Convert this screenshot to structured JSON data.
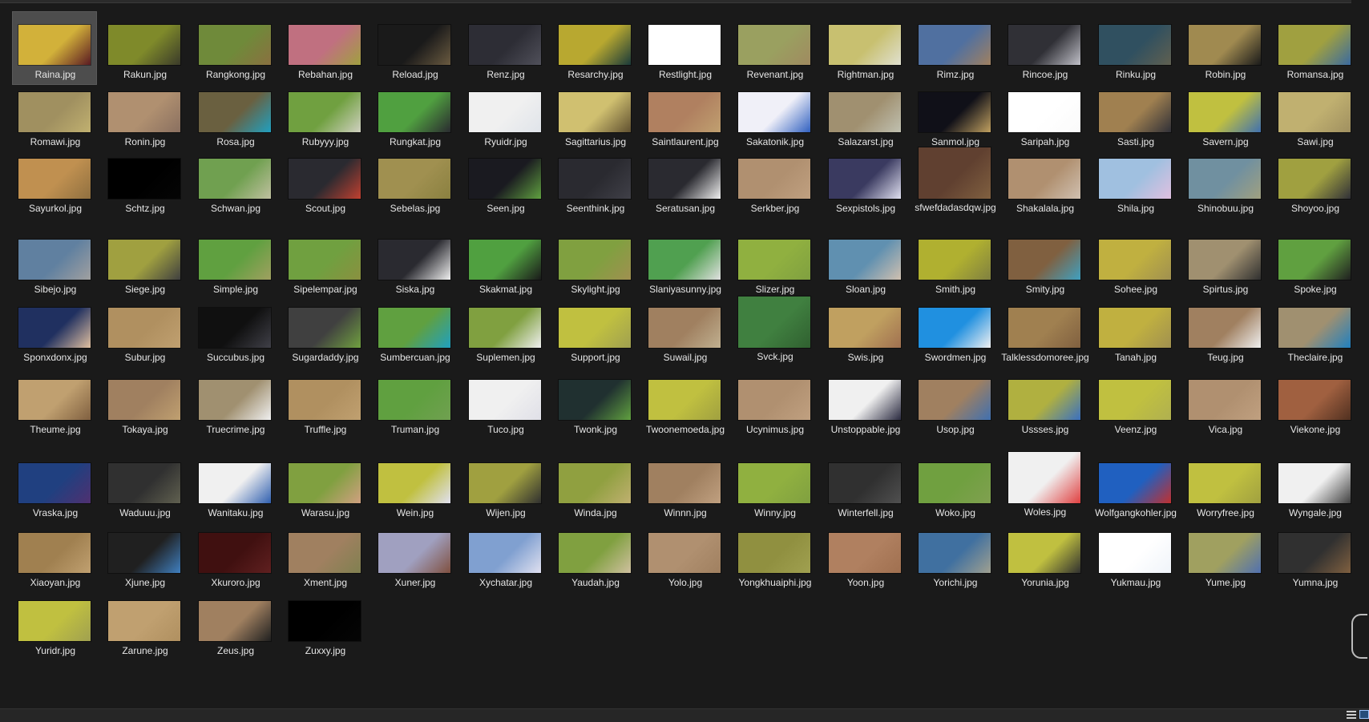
{
  "files": [
    {
      "name": "Raina.jpg",
      "thumb": [
        "#d2b13a",
        "#5a1a22"
      ],
      "selected": true
    },
    {
      "name": "Rakun.jpg",
      "thumb": [
        "#7f8a2a",
        "#3a3a2a"
      ]
    },
    {
      "name": "Rangkong.jpg",
      "thumb": [
        "#6f8a3a",
        "#8a7040"
      ]
    },
    {
      "name": "Rebahan.jpg",
      "thumb": [
        "#c07080",
        "#a0a040"
      ]
    },
    {
      "name": "Reload.jpg",
      "thumb": [
        "#1a1a1a",
        "#6a5a40"
      ]
    },
    {
      "name": "Renz.jpg",
      "thumb": [
        "#2d2d35",
        "#50505a"
      ]
    },
    {
      "name": "Resarchy.jpg",
      "thumb": [
        "#b8a830",
        "#1a3a3a"
      ]
    },
    {
      "name": "Restlight.jpg",
      "thumb": [
        "#ffffff",
        "#ffffff"
      ]
    },
    {
      "name": "Revenant.jpg",
      "thumb": [
        "#9aa060",
        "#a08a60"
      ]
    },
    {
      "name": "Rightman.jpg",
      "thumb": [
        "#c8c070",
        "#e0e0d0"
      ]
    },
    {
      "name": "Rimz.jpg",
      "thumb": [
        "#5070a0",
        "#a08060"
      ]
    },
    {
      "name": "Rincoe.jpg",
      "thumb": [
        "#303036",
        "#c0c0c8"
      ]
    },
    {
      "name": "Rinku.jpg",
      "thumb": [
        "#305060",
        "#606050"
      ]
    },
    {
      "name": "Robin.jpg",
      "thumb": [
        "#a08a50",
        "#1a1a1a"
      ]
    },
    {
      "name": "Romansa.jpg",
      "thumb": [
        "#a0a040",
        "#3a6aa0"
      ]
    },
    {
      "name": "Romawi.jpg",
      "thumb": [
        "#a09060",
        "#c0b070"
      ]
    },
    {
      "name": "Ronin.jpg",
      "thumb": [
        "#b09070",
        "#8a7060"
      ]
    },
    {
      "name": "Rosa.jpg",
      "thumb": [
        "#6a6040",
        "#20a0c0"
      ]
    },
    {
      "name": "Rubyyy.jpg",
      "thumb": [
        "#70a040",
        "#d0d0c0"
      ]
    },
    {
      "name": "Rungkat.jpg",
      "thumb": [
        "#50a040",
        "#2a2a30"
      ]
    },
    {
      "name": "Ryuidr.jpg",
      "thumb": [
        "#f0f0f0",
        "#e0e4ea"
      ]
    },
    {
      "name": "Sagittarius.jpg",
      "thumb": [
        "#d0c070",
        "#605030"
      ]
    },
    {
      "name": "Saintlaurent.jpg",
      "thumb": [
        "#b08060",
        "#c0a070"
      ]
    },
    {
      "name": "Sakatonik.jpg",
      "thumb": [
        "#f0f0f8",
        "#3060c0"
      ]
    },
    {
      "name": "Salazarst.jpg",
      "thumb": [
        "#a09070",
        "#c0c0b0"
      ]
    },
    {
      "name": "Sanmol.jpg",
      "thumb": [
        "#101018",
        "#c0a060"
      ]
    },
    {
      "name": "Saripah.jpg",
      "thumb": [
        "#ffffff",
        "#fafafa"
      ]
    },
    {
      "name": "Sasti.jpg",
      "thumb": [
        "#a08050",
        "#303038"
      ]
    },
    {
      "name": "Savern.jpg",
      "thumb": [
        "#c0c040",
        "#4070b0"
      ]
    },
    {
      "name": "Sawi.jpg",
      "thumb": [
        "#c0b070",
        "#a09060"
      ]
    },
    {
      "name": "Sayurkol.jpg",
      "thumb": [
        "#c09050",
        "#907040"
      ]
    },
    {
      "name": "Schtz.jpg",
      "thumb": [
        "#000000",
        "#050505"
      ]
    },
    {
      "name": "Schwan.jpg",
      "thumb": [
        "#70a050",
        "#c0c0a0"
      ]
    },
    {
      "name": "Scout.jpg",
      "thumb": [
        "#2a2a30",
        "#c04030"
      ]
    },
    {
      "name": "Sebelas.jpg",
      "thumb": [
        "#a09050",
        "#8a8040"
      ]
    },
    {
      "name": "Seen.jpg",
      "thumb": [
        "#1a1a20",
        "#60a040"
      ]
    },
    {
      "name": "Seenthink.jpg",
      "thumb": [
        "#2a2a30",
        "#404048"
      ]
    },
    {
      "name": "Seratusan.jpg",
      "thumb": [
        "#2a2a30",
        "#f0f0f0"
      ]
    },
    {
      "name": "Serkber.jpg",
      "thumb": [
        "#b09070",
        "#c0a080"
      ]
    },
    {
      "name": "Sexpistols.jpg",
      "thumb": [
        "#3a3a60",
        "#e0e0f0"
      ]
    },
    {
      "name": "sfwefdadasdqw.jpg",
      "thumb": [
        "#604030",
        "#806040"
      ],
      "tall": true
    },
    {
      "name": "Shakalala.jpg",
      "thumb": [
        "#b09070",
        "#d0c0b0"
      ]
    },
    {
      "name": "Shila.jpg",
      "thumb": [
        "#a0c0e0",
        "#e0c0e0"
      ]
    },
    {
      "name": "Shinobuu.jpg",
      "thumb": [
        "#7090a0",
        "#a0a080"
      ]
    },
    {
      "name": "Shoyoo.jpg",
      "thumb": [
        "#a0a040",
        "#303038"
      ]
    },
    {
      "name": "Sibejo.jpg",
      "thumb": [
        "#6080a0",
        "#a0a0a0"
      ]
    },
    {
      "name": "Siege.jpg",
      "thumb": [
        "#a0a040",
        "#404040"
      ]
    },
    {
      "name": "Simple.jpg",
      "thumb": [
        "#60a040",
        "#a0a060"
      ]
    },
    {
      "name": "Sipelempar.jpg",
      "thumb": [
        "#70a040",
        "#8a9040"
      ]
    },
    {
      "name": "Siska.jpg",
      "thumb": [
        "#2a2a30",
        "#f0f0f0"
      ]
    },
    {
      "name": "Skakmat.jpg",
      "thumb": [
        "#50a040",
        "#1a1a1a"
      ]
    },
    {
      "name": "Skylight.jpg",
      "thumb": [
        "#80a040",
        "#a09050"
      ]
    },
    {
      "name": "Slaniyasunny.jpg",
      "thumb": [
        "#50a050",
        "#e0e0e0"
      ]
    },
    {
      "name": "Slizer.jpg",
      "thumb": [
        "#90b040",
        "#80a040"
      ]
    },
    {
      "name": "Sloan.jpg",
      "thumb": [
        "#6090b0",
        "#d0c0b0"
      ]
    },
    {
      "name": "Smith.jpg",
      "thumb": [
        "#b0b030",
        "#808040"
      ]
    },
    {
      "name": "Smity.jpg",
      "thumb": [
        "#806040",
        "#40a0c0"
      ]
    },
    {
      "name": "Sohee.jpg",
      "thumb": [
        "#c0b040",
        "#a09050"
      ]
    },
    {
      "name": "Spirtus.jpg",
      "thumb": [
        "#a09070",
        "#303030"
      ]
    },
    {
      "name": "Spoke.jpg",
      "thumb": [
        "#60a040",
        "#202020"
      ]
    },
    {
      "name": "Sponxdonx.jpg",
      "thumb": [
        "#203060",
        "#e0c0a0"
      ]
    },
    {
      "name": "Subur.jpg",
      "thumb": [
        "#b09060",
        "#c0a070"
      ]
    },
    {
      "name": "Succubus.jpg",
      "thumb": [
        "#101010",
        "#404048"
      ]
    },
    {
      "name": "Sugardaddy.jpg",
      "thumb": [
        "#404040",
        "#70a040"
      ]
    },
    {
      "name": "Sumbercuan.jpg",
      "thumb": [
        "#60a040",
        "#20a0c0"
      ]
    },
    {
      "name": "Suplemen.jpg",
      "thumb": [
        "#80a040",
        "#f0f0f0"
      ]
    },
    {
      "name": "Support.jpg",
      "thumb": [
        "#c0c040",
        "#a0a050"
      ]
    },
    {
      "name": "Suwail.jpg",
      "thumb": [
        "#a08060",
        "#c0b090"
      ]
    },
    {
      "name": "Svck.jpg",
      "thumb": [
        "#408040",
        "#306030"
      ],
      "tall": true
    },
    {
      "name": "Swis.jpg",
      "thumb": [
        "#c0a060",
        "#a07050"
      ]
    },
    {
      "name": "Swordmen.jpg",
      "thumb": [
        "#2090e0",
        "#f0f0f0"
      ]
    },
    {
      "name": "Talklessdomoree.jpg",
      "thumb": [
        "#a08050",
        "#806040"
      ]
    },
    {
      "name": "Tanah.jpg",
      "thumb": [
        "#c0b040",
        "#a09050"
      ]
    },
    {
      "name": "Teug.jpg",
      "thumb": [
        "#a08060",
        "#f0f0f0"
      ]
    },
    {
      "name": "Theclaire.jpg",
      "thumb": [
        "#a09070",
        "#2080c0"
      ]
    },
    {
      "name": "Theume.jpg",
      "thumb": [
        "#c0a070",
        "#806040"
      ]
    },
    {
      "name": "Tokaya.jpg",
      "thumb": [
        "#a08060",
        "#c0a070"
      ]
    },
    {
      "name": "Truecrime.jpg",
      "thumb": [
        "#a09070",
        "#f0f0f0"
      ]
    },
    {
      "name": "Truffle.jpg",
      "thumb": [
        "#b09060",
        "#c0a070"
      ]
    },
    {
      "name": "Truman.jpg",
      "thumb": [
        "#60a040",
        "#70a050"
      ]
    },
    {
      "name": "Tuco.jpg",
      "thumb": [
        "#f0f0f0",
        "#e0e0e8"
      ]
    },
    {
      "name": "Twonk.jpg",
      "thumb": [
        "#203030",
        "#60a040"
      ]
    },
    {
      "name": "Twoonemoeda.jpg",
      "thumb": [
        "#c0c040",
        "#a0a040"
      ]
    },
    {
      "name": "Ucynimus.jpg",
      "thumb": [
        "#b09070",
        "#c0a080"
      ]
    },
    {
      "name": "Unstoppable.jpg",
      "thumb": [
        "#f0f0f0",
        "#2a2a40"
      ]
    },
    {
      "name": "Usop.jpg",
      "thumb": [
        "#a08060",
        "#4070b0"
      ]
    },
    {
      "name": "Ussses.jpg",
      "thumb": [
        "#b0b040",
        "#3a70c0"
      ]
    },
    {
      "name": "Veenz.jpg",
      "thumb": [
        "#c0c040",
        "#b0b050"
      ]
    },
    {
      "name": "Vica.jpg",
      "thumb": [
        "#b09070",
        "#c0a080"
      ]
    },
    {
      "name": "Viekone.jpg",
      "thumb": [
        "#a06040",
        "#503020"
      ]
    },
    {
      "name": "Vraska.jpg",
      "thumb": [
        "#204080",
        "#503070"
      ]
    },
    {
      "name": "Waduuu.jpg",
      "thumb": [
        "#303030",
        "#606050"
      ]
    },
    {
      "name": "Wanitaku.jpg",
      "thumb": [
        "#f0f0f0",
        "#3060b0"
      ]
    },
    {
      "name": "Warasu.jpg",
      "thumb": [
        "#80a040",
        "#d0a080"
      ]
    },
    {
      "name": "Wein.jpg",
      "thumb": [
        "#c0c040",
        "#e0e0f0"
      ]
    },
    {
      "name": "Wijen.jpg",
      "thumb": [
        "#a0a040",
        "#303030"
      ]
    },
    {
      "name": "Winda.jpg",
      "thumb": [
        "#90a040",
        "#c0b070"
      ]
    },
    {
      "name": "Winnn.jpg",
      "thumb": [
        "#a08060",
        "#c0a080"
      ]
    },
    {
      "name": "Winny.jpg",
      "thumb": [
        "#90b040",
        "#80a040"
      ]
    },
    {
      "name": "Winterfell.jpg",
      "thumb": [
        "#303030",
        "#505050"
      ]
    },
    {
      "name": "Woko.jpg",
      "thumb": [
        "#70a040",
        "#80a050"
      ]
    },
    {
      "name": "Woles.jpg",
      "thumb": [
        "#f0f0f0",
        "#e04040"
      ],
      "tall": true
    },
    {
      "name": "Wolfgangkohler.jpg",
      "thumb": [
        "#2060c0",
        "#c03030"
      ]
    },
    {
      "name": "Worryfree.jpg",
      "thumb": [
        "#c0c040",
        "#a0a040"
      ]
    },
    {
      "name": "Wyngale.jpg",
      "thumb": [
        "#f0f0f0",
        "#404040"
      ]
    },
    {
      "name": "Xiaoyan.jpg",
      "thumb": [
        "#a08050",
        "#c0a070"
      ]
    },
    {
      "name": "Xjune.jpg",
      "thumb": [
        "#202020",
        "#4080c0"
      ]
    },
    {
      "name": "Xkuroro.jpg",
      "thumb": [
        "#401010",
        "#602020"
      ]
    },
    {
      "name": "Xment.jpg",
      "thumb": [
        "#a08060",
        "#808050"
      ]
    },
    {
      "name": "Xuner.jpg",
      "thumb": [
        "#a0a0c0",
        "#805040"
      ]
    },
    {
      "name": "Xychatar.jpg",
      "thumb": [
        "#80a0d0",
        "#e0e0f0"
      ]
    },
    {
      "name": "Yaudah.jpg",
      "thumb": [
        "#80a040",
        "#d0c0a0"
      ]
    },
    {
      "name": "Yolo.jpg",
      "thumb": [
        "#b09070",
        "#a08060"
      ]
    },
    {
      "name": "Yongkhuaiphi.jpg",
      "thumb": [
        "#909040",
        "#a0a050"
      ]
    },
    {
      "name": "Yoon.jpg",
      "thumb": [
        "#b08060",
        "#a07050"
      ]
    },
    {
      "name": "Yorichi.jpg",
      "thumb": [
        "#4070a0",
        "#a0a090"
      ]
    },
    {
      "name": "Yorunia.jpg",
      "thumb": [
        "#c0c040",
        "#303030"
      ]
    },
    {
      "name": "Yukmau.jpg",
      "thumb": [
        "#ffffff",
        "#f0f4fa"
      ]
    },
    {
      "name": "Yume.jpg",
      "thumb": [
        "#a0a060",
        "#5070b0"
      ]
    },
    {
      "name": "Yumna.jpg",
      "thumb": [
        "#303030",
        "#806040"
      ]
    },
    {
      "name": "Yuridr.jpg",
      "thumb": [
        "#c0c040",
        "#a0a050"
      ]
    },
    {
      "name": "Zarune.jpg",
      "thumb": [
        "#c0a070",
        "#b09060"
      ]
    },
    {
      "name": "Zeus.jpg",
      "thumb": [
        "#a08060",
        "#202020"
      ]
    },
    {
      "name": "Zuxxy.jpg",
      "thumb": [
        "#000000",
        "#050505"
      ]
    }
  ]
}
